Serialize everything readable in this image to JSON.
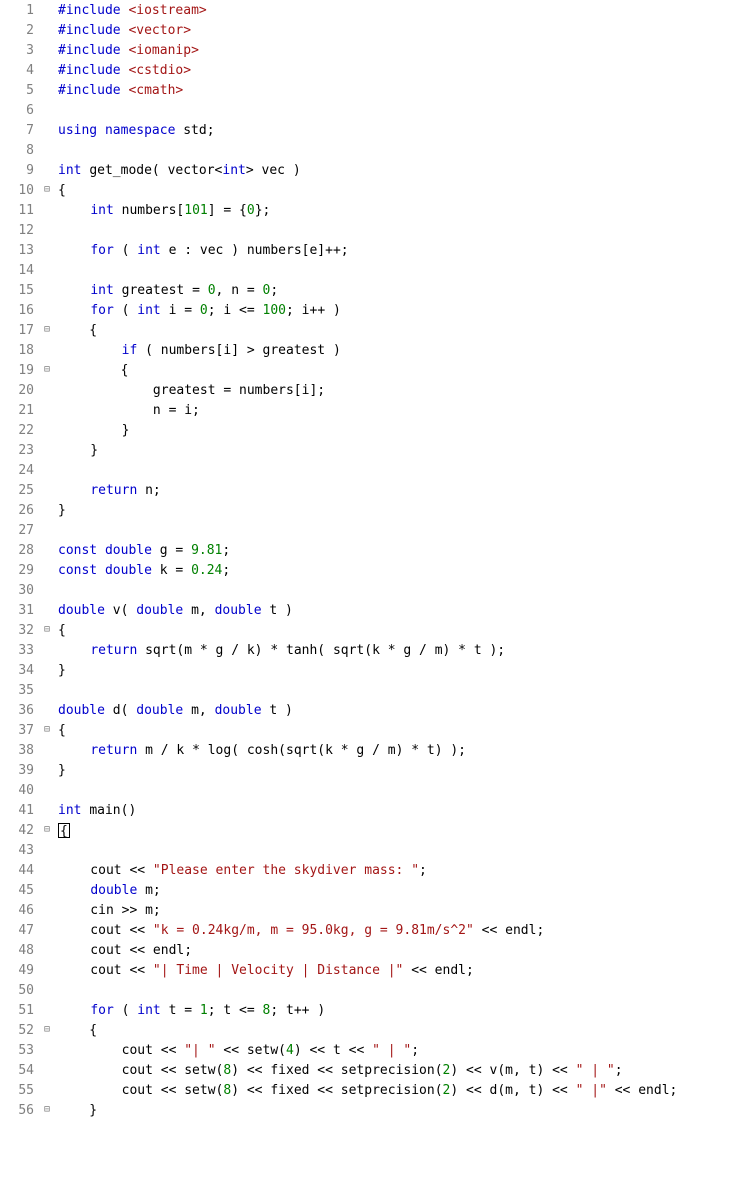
{
  "lines": [
    {
      "n": 1,
      "fold": "",
      "tokens": [
        [
          "pp",
          "#include "
        ],
        [
          "hdr",
          "<iostream>"
        ]
      ]
    },
    {
      "n": 2,
      "fold": "",
      "tokens": [
        [
          "pp",
          "#include "
        ],
        [
          "hdr",
          "<vector>"
        ]
      ]
    },
    {
      "n": 3,
      "fold": "",
      "tokens": [
        [
          "pp",
          "#include "
        ],
        [
          "hdr",
          "<iomanip>"
        ]
      ]
    },
    {
      "n": 4,
      "fold": "",
      "tokens": [
        [
          "pp",
          "#include "
        ],
        [
          "hdr",
          "<cstdio>"
        ]
      ]
    },
    {
      "n": 5,
      "fold": "",
      "tokens": [
        [
          "pp",
          "#include "
        ],
        [
          "hdr",
          "<cmath>"
        ]
      ]
    },
    {
      "n": 6,
      "fold": "",
      "tokens": []
    },
    {
      "n": 7,
      "fold": "",
      "tokens": [
        [
          "kw",
          "using namespace "
        ],
        [
          "id",
          "std"
        ],
        [
          "op",
          ";"
        ]
      ]
    },
    {
      "n": 8,
      "fold": "",
      "tokens": []
    },
    {
      "n": 9,
      "fold": "",
      "tokens": [
        [
          "type",
          "int "
        ],
        [
          "id",
          "get_mode( vector<"
        ],
        [
          "type",
          "int"
        ],
        [
          "id",
          "> vec )"
        ]
      ]
    },
    {
      "n": 10,
      "fold": "⊟",
      "tokens": [
        [
          "op",
          "{"
        ]
      ]
    },
    {
      "n": 11,
      "fold": "│",
      "tokens": [
        [
          "op",
          "    "
        ],
        [
          "type",
          "int "
        ],
        [
          "id",
          "numbers["
        ],
        [
          "num",
          "101"
        ],
        [
          "id",
          "] = {"
        ],
        [
          "num",
          "0"
        ],
        [
          "id",
          "};"
        ]
      ]
    },
    {
      "n": 12,
      "fold": "│",
      "tokens": []
    },
    {
      "n": 13,
      "fold": "│",
      "tokens": [
        [
          "op",
          "    "
        ],
        [
          "kw",
          "for "
        ],
        [
          "id",
          "( "
        ],
        [
          "type",
          "int "
        ],
        [
          "id",
          "e : vec ) numbers[e]++;"
        ]
      ]
    },
    {
      "n": 14,
      "fold": "│",
      "tokens": []
    },
    {
      "n": 15,
      "fold": "│",
      "tokens": [
        [
          "op",
          "    "
        ],
        [
          "type",
          "int "
        ],
        [
          "id",
          "greatest = "
        ],
        [
          "num",
          "0"
        ],
        [
          "id",
          ", n = "
        ],
        [
          "num",
          "0"
        ],
        [
          "id",
          ";"
        ]
      ]
    },
    {
      "n": 16,
      "fold": "│",
      "tokens": [
        [
          "op",
          "    "
        ],
        [
          "kw",
          "for "
        ],
        [
          "id",
          "( "
        ],
        [
          "type",
          "int "
        ],
        [
          "id",
          "i = "
        ],
        [
          "num",
          "0"
        ],
        [
          "id",
          "; i <= "
        ],
        [
          "num",
          "100"
        ],
        [
          "id",
          "; i++ )"
        ]
      ]
    },
    {
      "n": 17,
      "fold": "⊟",
      "tokens": [
        [
          "op",
          "    {"
        ]
      ]
    },
    {
      "n": 18,
      "fold": "│",
      "tokens": [
        [
          "op",
          "        "
        ],
        [
          "kw",
          "if "
        ],
        [
          "id",
          "( numbers[i] > greatest )"
        ]
      ]
    },
    {
      "n": 19,
      "fold": "⊟",
      "tokens": [
        [
          "op",
          "        {"
        ]
      ]
    },
    {
      "n": 20,
      "fold": "│",
      "tokens": [
        [
          "op",
          "            greatest = numbers[i];"
        ]
      ]
    },
    {
      "n": 21,
      "fold": "│",
      "tokens": [
        [
          "op",
          "            n = i;"
        ]
      ]
    },
    {
      "n": 22,
      "fold": "│",
      "tokens": [
        [
          "op",
          "        }"
        ]
      ]
    },
    {
      "n": 23,
      "fold": "│",
      "tokens": [
        [
          "op",
          "    }"
        ]
      ]
    },
    {
      "n": 24,
      "fold": "│",
      "tokens": []
    },
    {
      "n": 25,
      "fold": "│",
      "tokens": [
        [
          "op",
          "    "
        ],
        [
          "kw",
          "return "
        ],
        [
          "id",
          "n;"
        ]
      ]
    },
    {
      "n": 26,
      "fold": "",
      "tokens": [
        [
          "op",
          "}"
        ]
      ]
    },
    {
      "n": 27,
      "fold": "",
      "tokens": []
    },
    {
      "n": 28,
      "fold": "",
      "tokens": [
        [
          "kw",
          "const "
        ],
        [
          "type",
          "double "
        ],
        [
          "id",
          "g = "
        ],
        [
          "num",
          "9.81"
        ],
        [
          "id",
          ";"
        ]
      ]
    },
    {
      "n": 29,
      "fold": "",
      "tokens": [
        [
          "kw",
          "const "
        ],
        [
          "type",
          "double "
        ],
        [
          "id",
          "k = "
        ],
        [
          "num",
          "0.24"
        ],
        [
          "id",
          ";"
        ]
      ]
    },
    {
      "n": 30,
      "fold": "",
      "tokens": []
    },
    {
      "n": 31,
      "fold": "",
      "tokens": [
        [
          "type",
          "double "
        ],
        [
          "id",
          "v( "
        ],
        [
          "type",
          "double "
        ],
        [
          "id",
          "m, "
        ],
        [
          "type",
          "double "
        ],
        [
          "id",
          "t )"
        ]
      ]
    },
    {
      "n": 32,
      "fold": "⊟",
      "tokens": [
        [
          "op",
          "{"
        ]
      ]
    },
    {
      "n": 33,
      "fold": "│",
      "tokens": [
        [
          "op",
          "    "
        ],
        [
          "kw",
          "return "
        ],
        [
          "id",
          "sqrt(m * g / k) * tanh( sqrt(k * g / m) * t );"
        ]
      ]
    },
    {
      "n": 34,
      "fold": "",
      "tokens": [
        [
          "op",
          "}"
        ]
      ]
    },
    {
      "n": 35,
      "fold": "",
      "tokens": []
    },
    {
      "n": 36,
      "fold": "",
      "tokens": [
        [
          "type",
          "double "
        ],
        [
          "id",
          "d( "
        ],
        [
          "type",
          "double "
        ],
        [
          "id",
          "m, "
        ],
        [
          "type",
          "double "
        ],
        [
          "id",
          "t )"
        ]
      ]
    },
    {
      "n": 37,
      "fold": "⊟",
      "tokens": [
        [
          "op",
          "{"
        ]
      ]
    },
    {
      "n": 38,
      "fold": "│",
      "tokens": [
        [
          "op",
          "    "
        ],
        [
          "kw",
          "return "
        ],
        [
          "id",
          "m / k * log( cosh(sqrt(k * g / m) * t) );"
        ]
      ]
    },
    {
      "n": 39,
      "fold": "",
      "tokens": [
        [
          "op",
          "}"
        ]
      ]
    },
    {
      "n": 40,
      "fold": "",
      "tokens": []
    },
    {
      "n": 41,
      "fold": "",
      "tokens": [
        [
          "type",
          "int "
        ],
        [
          "id",
          "main()"
        ]
      ]
    },
    {
      "n": 42,
      "fold": "⊟",
      "tokens": [
        [
          "caret",
          "{"
        ]
      ]
    },
    {
      "n": 43,
      "fold": "│",
      "tokens": []
    },
    {
      "n": 44,
      "fold": "│",
      "tokens": [
        [
          "op",
          "    cout << "
        ],
        [
          "str",
          "\"Please enter the skydiver mass: \""
        ],
        [
          "op",
          ";"
        ]
      ]
    },
    {
      "n": 45,
      "fold": "│",
      "tokens": [
        [
          "op",
          "    "
        ],
        [
          "type",
          "double "
        ],
        [
          "id",
          "m;"
        ]
      ]
    },
    {
      "n": 46,
      "fold": "│",
      "tokens": [
        [
          "op",
          "    cin >> m;"
        ]
      ]
    },
    {
      "n": 47,
      "fold": "│",
      "tokens": [
        [
          "op",
          "    cout << "
        ],
        [
          "str",
          "\"k = 0.24kg/m, m = 95.0kg, g = 9.81m/s^2\""
        ],
        [
          "op",
          " << endl;"
        ]
      ]
    },
    {
      "n": 48,
      "fold": "│",
      "tokens": [
        [
          "op",
          "    cout << endl;"
        ]
      ]
    },
    {
      "n": 49,
      "fold": "│",
      "tokens": [
        [
          "op",
          "    cout << "
        ],
        [
          "str",
          "\"| Time | Velocity | Distance |\""
        ],
        [
          "op",
          " << endl;"
        ]
      ]
    },
    {
      "n": 50,
      "fold": "│",
      "tokens": []
    },
    {
      "n": 51,
      "fold": "│",
      "tokens": [
        [
          "op",
          "    "
        ],
        [
          "kw",
          "for "
        ],
        [
          "id",
          "( "
        ],
        [
          "type",
          "int "
        ],
        [
          "id",
          "t = "
        ],
        [
          "num",
          "1"
        ],
        [
          "id",
          "; t <= "
        ],
        [
          "num",
          "8"
        ],
        [
          "id",
          "; t++ )"
        ]
      ]
    },
    {
      "n": 52,
      "fold": "⊟",
      "tokens": [
        [
          "op",
          "    {"
        ]
      ]
    },
    {
      "n": 53,
      "fold": "│",
      "tokens": [
        [
          "op",
          "        cout << "
        ],
        [
          "str",
          "\"| \""
        ],
        [
          "op",
          " << setw("
        ],
        [
          "num",
          "4"
        ],
        [
          "op",
          ") << t << "
        ],
        [
          "str",
          "\" | \""
        ],
        [
          "op",
          ";"
        ]
      ]
    },
    {
      "n": 54,
      "fold": "│",
      "tokens": [
        [
          "op",
          "        cout << setw("
        ],
        [
          "num",
          "8"
        ],
        [
          "op",
          ") << fixed << setprecision("
        ],
        [
          "num",
          "2"
        ],
        [
          "op",
          ") << v(m, t) << "
        ],
        [
          "str",
          "\" | \""
        ],
        [
          "op",
          ";"
        ]
      ]
    },
    {
      "n": 55,
      "fold": "│",
      "tokens": [
        [
          "op",
          "        cout << setw("
        ],
        [
          "num",
          "8"
        ],
        [
          "op",
          ") << fixed << setprecision("
        ],
        [
          "num",
          "2"
        ],
        [
          "op",
          ") << d(m, t) << "
        ],
        [
          "str",
          "\" |\""
        ],
        [
          "op",
          " << endl;"
        ]
      ]
    },
    {
      "n": 56,
      "fold": "⊟",
      "tokens": [
        [
          "op",
          "    }"
        ]
      ]
    }
  ]
}
